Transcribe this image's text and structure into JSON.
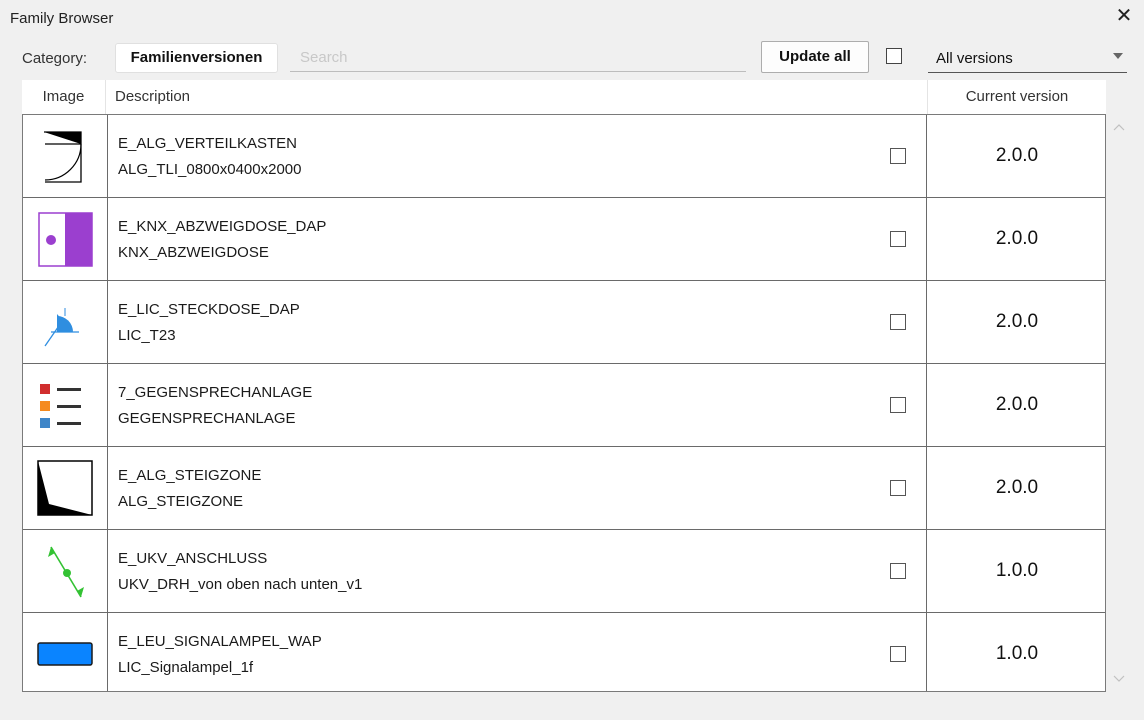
{
  "window": {
    "title": "Family Browser"
  },
  "toolbar": {
    "category_label": "Category:",
    "category_value": "Familienversionen",
    "search_placeholder": "Search",
    "update_all_label": "Update all",
    "version_filter": "All versions"
  },
  "table": {
    "columns": {
      "image": "Image",
      "description": "Description",
      "current_version": "Current version"
    },
    "rows": [
      {
        "icon": "electrical-box-icon",
        "name": "E_ALG_VERTEILKASTEN",
        "type": "ALG_TLI_0800x0400x2000",
        "version": "2.0.0"
      },
      {
        "icon": "junction-box-icon",
        "name": "E_KNX_ABZWEIGDOSE_DAP",
        "type": "KNX_ABZWEIGDOSE",
        "version": "2.0.0"
      },
      {
        "icon": "socket-icon",
        "name": "E_LIC_STECKDOSE_DAP",
        "type": "LIC_T23",
        "version": "2.0.0"
      },
      {
        "icon": "intercom-list-icon",
        "name": "7_GEGENSPRECHANLAGE",
        "type": "GEGENSPRECHANLAGE",
        "version": "2.0.0"
      },
      {
        "icon": "riser-zone-icon",
        "name": "E_ALG_STEIGZONE",
        "type": "ALG_STEIGZONE",
        "version": "2.0.0"
      },
      {
        "icon": "cable-connection-icon",
        "name": "E_UKV_ANSCHLUSS",
        "type": "UKV_DRH_von oben nach unten_v1",
        "version": "1.0.0"
      },
      {
        "icon": "signal-lamp-icon",
        "name": "E_LEU_SIGNALAMPEL_WAP",
        "type": "LIC_Signalampel_1f",
        "version": "1.0.0"
      }
    ]
  },
  "colors": {
    "accent_purple": "#9b3fcf",
    "socket_blue": "#2f8ee0",
    "lamp_blue": "#0a84ff",
    "cable_green": "#33c233",
    "list_red": "#d12e2e",
    "list_orange": "#f58a1f",
    "list_blue": "#3f86c8"
  }
}
